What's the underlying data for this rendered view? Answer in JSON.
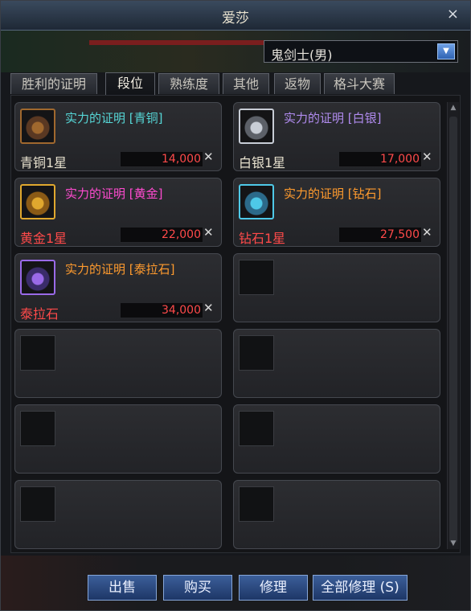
{
  "window": {
    "title": "爱莎",
    "close_glyph": "×"
  },
  "character_select": {
    "value": "鬼剑士(男)",
    "arrow_glyph": "▼"
  },
  "tabs": [
    {
      "label": "胜利的证明"
    },
    {
      "label": "段位",
      "active": true
    },
    {
      "label": "熟练度"
    },
    {
      "label": "其他"
    },
    {
      "label": "返物"
    },
    {
      "label": "格斗大赛"
    }
  ],
  "items": [
    {
      "name": "实力的证明 [青铜]",
      "grade": "青铜1星",
      "price": "14,000",
      "name_color": "#56d7d7",
      "grade_color": "#e8e2cf",
      "border_color": "#a0682e",
      "icon_fill": "#5a3822",
      "icon": "bronze-medal-icon"
    },
    {
      "name": "实力的证明 [白银]",
      "grade": "白银1星",
      "price": "17,000",
      "name_color": "#b18cf0",
      "grade_color": "#e8e2cf",
      "border_color": "#c8cdd6",
      "icon_fill": "#5c6068",
      "icon": "silver-medal-icon"
    },
    {
      "name": "实力的证明 [黄金]",
      "grade": "黄金1星",
      "price": "22,000",
      "name_color": "#ff4bd0",
      "grade_color": "#ff4a4a",
      "border_color": "#e0a82e",
      "icon_fill": "#8a5a16",
      "icon": "gold-medal-icon"
    },
    {
      "name": "实力的证明 [钻石]",
      "grade": "钻石1星",
      "price": "27,500",
      "name_color": "#ff9b2e",
      "grade_color": "#ff4a4a",
      "border_color": "#4ec9e8",
      "icon_fill": "#2c6a8a",
      "icon": "diamond-medal-icon"
    },
    {
      "name": "实力的证明 [泰拉石]",
      "grade": "泰拉石",
      "price": "34,000",
      "name_color": "#ff9b2e",
      "grade_color": "#ff4a4a",
      "border_color": "#9a6ae8",
      "icon_fill": "#3a2c6a",
      "icon": "terra-medal-icon"
    }
  ],
  "empty_slots": 7,
  "tools_glyph": "✕",
  "buttons": {
    "sell": "出售",
    "buy": "购买",
    "repair": "修理",
    "repair_all": "全部修理 (S)"
  }
}
